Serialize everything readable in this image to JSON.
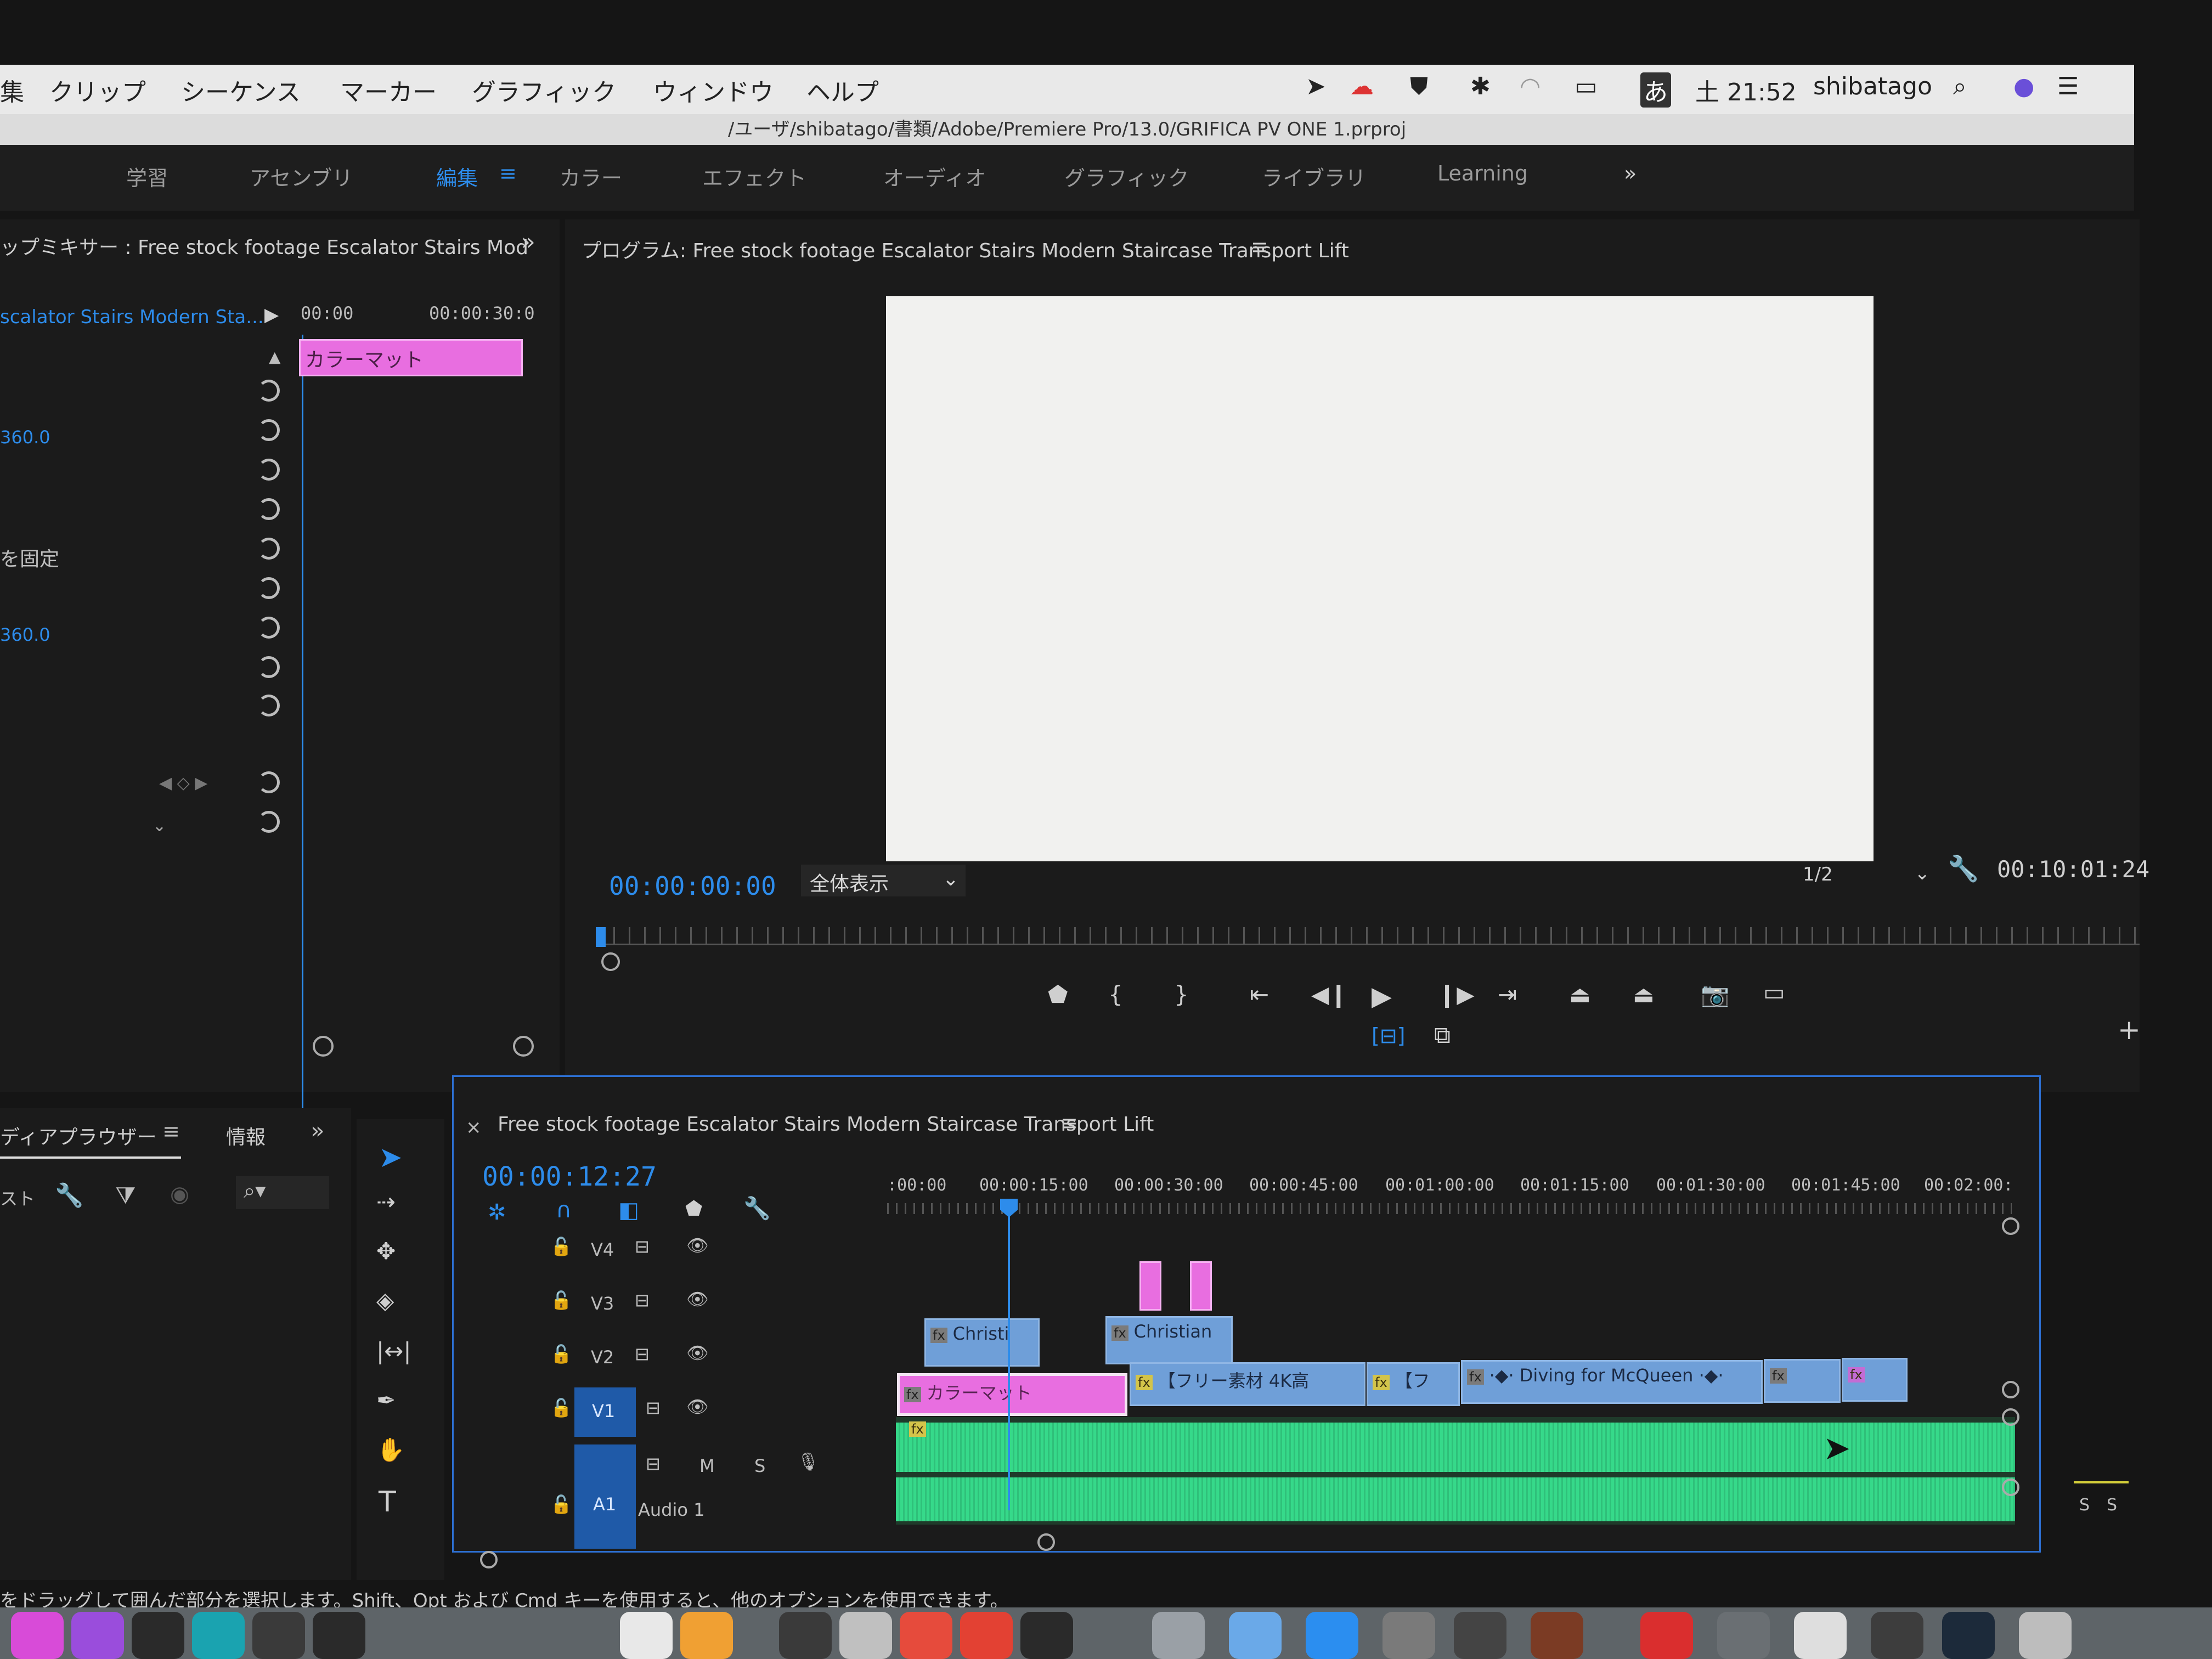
{
  "menubar": {
    "items": [
      "集",
      "クリップ",
      "シーケンス",
      "マーカー",
      "グラフィック",
      "ウィンドウ",
      "ヘルプ"
    ],
    "clock": "土 21:52",
    "user": "shibatago",
    "ime": "あ"
  },
  "path": "/ユーザ/shibatago/書類/Adobe/Premiere Pro/13.0/GRIFICA PV ONE 1.prproj",
  "workspaces": [
    "学習",
    "アセンブリ",
    "編集",
    "カラー",
    "エフェクト",
    "オーディオ",
    "グラフィック",
    "ライブラリ",
    "Learning"
  ],
  "active_workspace": "編集",
  "clip_mixer": {
    "title": "ップミキサー : Free stock footage Escalator Stairs Mod",
    "clip_name": "scalator Stairs Modern Sta...",
    "time_start": "00:00",
    "time_end": "00:00:30:0",
    "clip_label": "カラーマット",
    "value1": "360.0",
    "lock_label": "を固定",
    "value2": "360.0"
  },
  "program": {
    "title": "プログラム: Free stock footage Escalator Stairs Modern Staircase Transport Lift",
    "timecode": "00:00:00:00",
    "fit": "全体表示",
    "resolution": "1/2",
    "duration": "00:10:01:24"
  },
  "media_browser": {
    "tab1": "ディアプラウザー",
    "tab2": "情報",
    "list_label": "スト"
  },
  "timeline": {
    "title": "Free stock footage Escalator Stairs Modern Staircase Transport Lift",
    "timecode": "00:00:12:27",
    "ruler": [
      ":00:00",
      "00:00:15:00",
      "00:00:30:00",
      "00:00:45:00",
      "00:01:00:00",
      "00:01:15:00",
      "00:01:30:00",
      "00:01:45:00",
      "00:02:00:"
    ],
    "tracks": [
      {
        "name": "V4"
      },
      {
        "name": "V3"
      },
      {
        "name": "V2"
      },
      {
        "name": "V1"
      }
    ],
    "audio_track": {
      "name": "A1",
      "label": "Audio 1",
      "m": "M",
      "s": "S"
    },
    "clips_v2": [
      "Christi",
      "Christian"
    ],
    "clips_v1": [
      "カラーマット",
      "【フリー素材 4K高",
      "【フ",
      "·◆· Diving for McQueen ·◆·"
    ]
  },
  "status_text": "をドラッグして囲んだ部分を選択します。Shift、Opt および Cmd キーを使用すると、他のオプションを使用できます。",
  "meter_labels": [
    "S",
    "S"
  ],
  "colors": {
    "accent": "#2d8ceb",
    "clip_blue": "#6f9fd8",
    "clip_pink": "#e86ee0",
    "audio_green": "#36d98a"
  }
}
